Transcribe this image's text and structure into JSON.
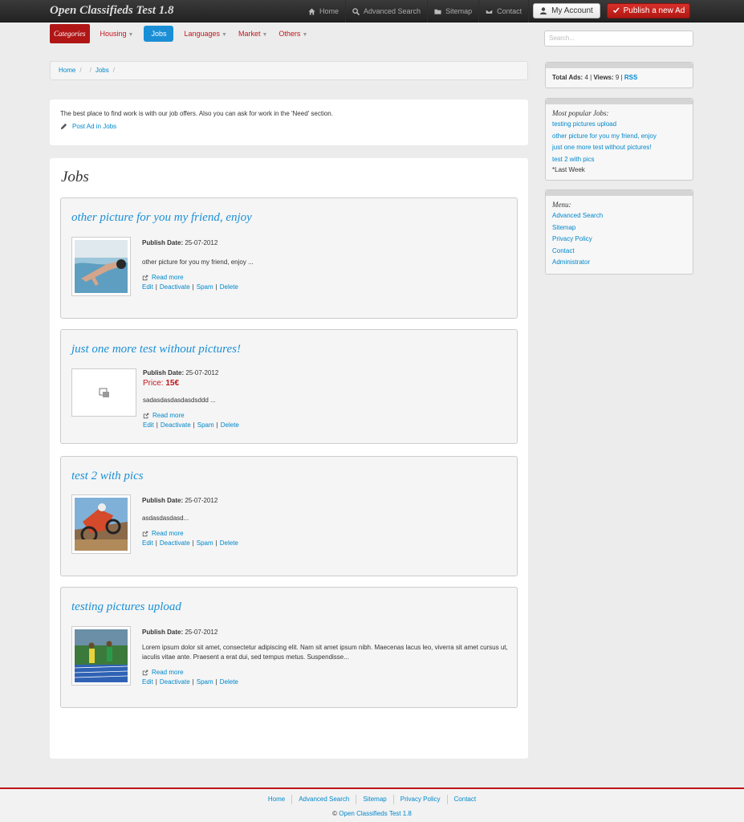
{
  "brand": "Open Classifieds Test 1.8",
  "topnav": {
    "home": "Home",
    "advanced_search": "Advanced Search",
    "sitemap": "Sitemap",
    "contact": "Contact",
    "my_account": "My Account",
    "publish": "Publish a new Ad"
  },
  "categories": {
    "title": "Categories",
    "items": [
      "Housing",
      "Jobs",
      "Languages",
      "Market",
      "Others"
    ],
    "active": "Jobs"
  },
  "search": {
    "placeholder": "Search..."
  },
  "breadcrumb": {
    "home": "Home",
    "sep": "/",
    "current": "Jobs"
  },
  "intro": {
    "description": "The best place to find work is with our job offers. Also you can ask for work in the 'Need' section.",
    "post_ad": "Post Ad in Jobs"
  },
  "main": {
    "heading": "Jobs",
    "publish_label": "Publish Date:",
    "price_label": "Price:",
    "read_more": "Read more",
    "actions": [
      "Edit",
      "Deactivate",
      "Spam",
      "Delete"
    ],
    "ads": [
      {
        "title": "other picture for you my friend, enjoy",
        "date": "25-07-2012",
        "text": "other picture for you my friend, enjoy ..."
      },
      {
        "title": "just one more test without pictures!",
        "date": "25-07-2012",
        "price": "15€",
        "text": "sadasdasdasdasdsddd ..."
      },
      {
        "title": "test 2 with pics",
        "date": "25-07-2012",
        "text": "asdasdasdasd..."
      },
      {
        "title": "testing pictures upload",
        "date": "25-07-2012",
        "text": "Lorem ipsum dolor sit amet, consectetur adipiscing elit. Nam sit amet ipsum nibh. Maecenas lacus leo, viverra sit amet cursus ut, iaculis vitae ante. Praesent a erat dui, sed tempus metus. Suspendisse..."
      }
    ]
  },
  "sidebar": {
    "stats": {
      "total_label": "Total Ads:",
      "total": "4",
      "sep": "|",
      "views_label": "Views:",
      "views": "9",
      "rss": "RSS"
    },
    "popular": {
      "heading": "Most popular Jobs:",
      "items": [
        "testing pictures upload",
        "other picture for you my friend, enjoy",
        "just one more test without pictures!",
        "test 2 with pics"
      ],
      "note": "*Last Week"
    },
    "menu": {
      "heading": "Menu:",
      "items": [
        "Advanced Search",
        "Sitemap",
        "Privacy Policy",
        "Contact",
        "Administrator"
      ]
    }
  },
  "footer": {
    "links": [
      "Home",
      "Advanced Search",
      "Sitemap",
      "Privacy Policy",
      "Contact"
    ],
    "copyright_symbol": "©",
    "copyright_link": "Open Classifieds Test 1.8"
  }
}
